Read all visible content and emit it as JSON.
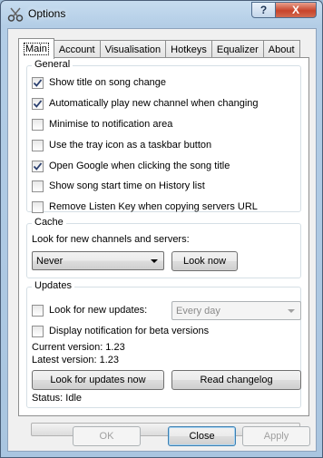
{
  "window": {
    "title": "Options",
    "help_glyph": "?",
    "close_glyph": "X"
  },
  "tabs": [
    {
      "label": "Main"
    },
    {
      "label": "Account"
    },
    {
      "label": "Visualisation"
    },
    {
      "label": "Hotkeys"
    },
    {
      "label": "Equalizer"
    },
    {
      "label": "About"
    }
  ],
  "general": {
    "legend": "General",
    "options": [
      {
        "label": "Show title on song change",
        "checked": true
      },
      {
        "label": "Automatically play new channel when changing",
        "checked": true
      },
      {
        "label": "Minimise to notification area",
        "checked": false
      },
      {
        "label": "Use the tray icon as a taskbar button",
        "checked": false
      },
      {
        "label": "Open Google when clicking the song title",
        "checked": true
      },
      {
        "label": "Show song start time on History list",
        "checked": false
      },
      {
        "label": "Remove Listen Key when copying servers URL",
        "checked": false
      }
    ]
  },
  "cache": {
    "legend": "Cache",
    "prompt": "Look for new channels and servers:",
    "selected": "Never",
    "look_now_label": "Look now"
  },
  "updates": {
    "legend": "Updates",
    "look_new_label": "Look for new updates:",
    "look_new_checked": false,
    "interval_selected": "Every day",
    "beta_label": "Display notification for beta versions",
    "beta_checked": false,
    "current_version": "Current version: 1.23",
    "latest_version": "Latest version: 1.23",
    "look_now_label": "Look for updates now",
    "changelog_label": "Read changelog",
    "status": "Status: Idle",
    "progress": 0
  },
  "footer": {
    "ok_label": "OK",
    "close_label": "Close",
    "apply_label": "Apply"
  }
}
